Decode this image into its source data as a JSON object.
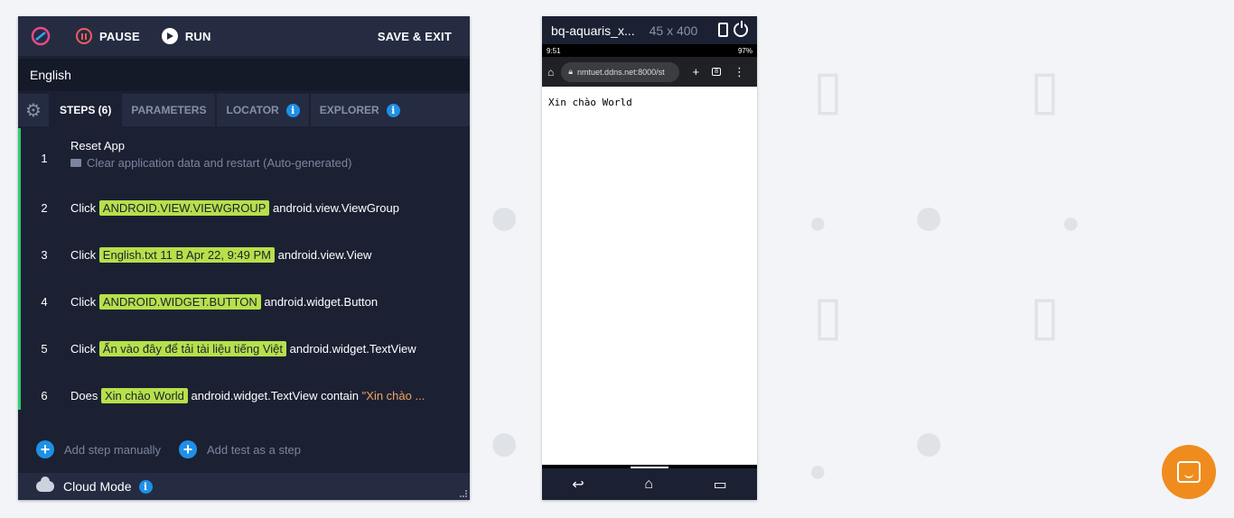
{
  "toolbar": {
    "pause_label": "PAUSE",
    "run_label": "RUN",
    "save_exit_label": "SAVE & EXIT"
  },
  "test_name": "English",
  "tabs": [
    {
      "label": "STEPS (6)",
      "active": true
    },
    {
      "label": "PARAMETERS",
      "active": false
    },
    {
      "label": "LOCATOR",
      "active": false,
      "info": true
    },
    {
      "label": "EXPLORER",
      "active": false,
      "info": true
    }
  ],
  "steps": [
    {
      "num": "1",
      "title": "Reset App",
      "subtitle": "Clear application data and restart (Auto-generated)"
    },
    {
      "num": "2",
      "action": "Click",
      "highlight": "ANDROID.VIEW.VIEWGROUP",
      "target": "android.view.ViewGroup"
    },
    {
      "num": "3",
      "action": "Click",
      "highlight": "English.txt 11 B Apr 22, 9:49 PM",
      "target": "android.view.View"
    },
    {
      "num": "4",
      "action": "Click",
      "highlight": "ANDROID.WIDGET.BUTTON",
      "target": "android.widget.Button"
    },
    {
      "num": "5",
      "action": "Click",
      "highlight": "Ấn vào đây để tải tài liệu tiếng Việt",
      "target": "android.widget.TextView"
    },
    {
      "num": "6",
      "action": "Does",
      "highlight": "Xin chào World",
      "target": "android.widget.TextView contain",
      "value": "\"Xin chào ..."
    }
  ],
  "add_actions": {
    "manual": "Add step manually",
    "test": "Add test as a step"
  },
  "cloud_mode_label": "Cloud Mode",
  "info_glyph": "i",
  "device": {
    "name": "bq-aquaris_x...",
    "resolution": "45 x 400",
    "status_time": "9:51",
    "status_right": "97%",
    "url": "nmtuet.ddns.net:8000/st",
    "tab_count": "8",
    "page_text": "Xin chào World"
  },
  "colors": {
    "panel_bg": "#1b2133",
    "highlight": "#b7e04a",
    "accent_blue": "#1e90e8",
    "pause_red": "#ee5d5d",
    "step_bar": "#2ecc71",
    "chat_orange": "#f08c1d"
  },
  "icons": [
    "app-logo-icon",
    "pause-icon",
    "play-icon",
    "gear-icon",
    "info-icon",
    "comment-icon",
    "plus-icon",
    "cloud-icon",
    "rotate-icon",
    "power-icon",
    "home-icon",
    "lock-icon",
    "plus-tab-icon",
    "tabs-icon",
    "menu-icon",
    "back-icon",
    "home-nav-icon",
    "recents-icon",
    "chat-icon"
  ]
}
